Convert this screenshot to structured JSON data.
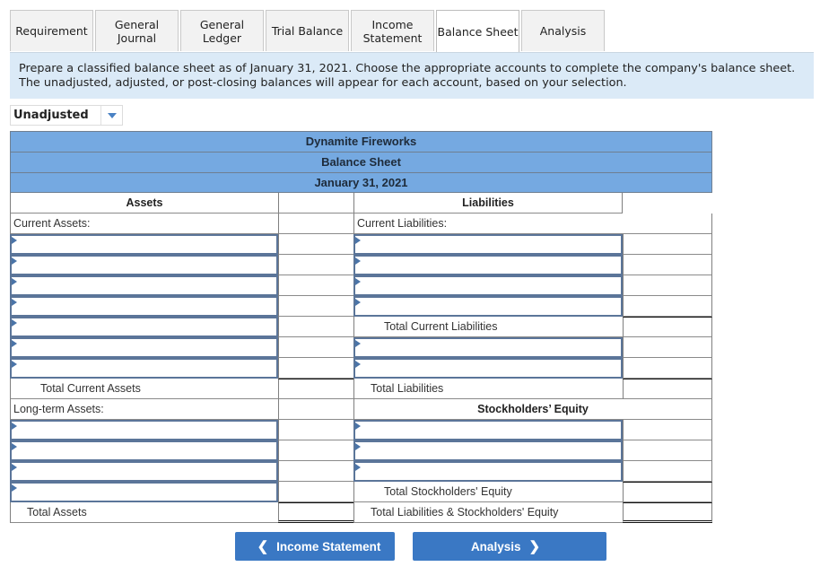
{
  "tabs": [
    {
      "label": "Requirement",
      "active": false
    },
    {
      "label": "General Journal",
      "active": false
    },
    {
      "label": "General Ledger",
      "active": false
    },
    {
      "label": "Trial Balance",
      "active": false
    },
    {
      "label": "Income Statement",
      "active": false
    },
    {
      "label": "Balance Sheet",
      "active": true
    },
    {
      "label": "Analysis",
      "active": false
    }
  ],
  "instructions": "Prepare a classified balance sheet as of January 31, 2021. Choose the appropriate accounts to complete the company's balance sheet. The unadjusted, adjusted, or post-closing balances will appear for each account, based on your selection.",
  "balance_selector": {
    "selected": "Unadjusted"
  },
  "sheet": {
    "company": "Dynamite Fireworks",
    "title": "Balance Sheet",
    "date": "January 31, 2021",
    "assets_header": "Assets",
    "liabilities_header": "Liabilities",
    "current_assets_label": "Current Assets:",
    "current_liabilities_label": "Current Liabilities:",
    "total_current_assets": "Total Current Assets",
    "total_current_liabilities": "Total Current Liabilities",
    "total_liabilities": "Total Liabilities",
    "long_term_assets_label": "Long-term Assets:",
    "equity_header": "Stockholders’ Equity",
    "total_equity": "Total Stockholders' Equity",
    "total_assets": "Total Assets",
    "total_liabilities_equity": "Total Liabilities & Stockholders' Equity"
  },
  "nav": {
    "prev_label": "Income Statement",
    "next_label": "Analysis",
    "prev_icon": "chevron-left-icon",
    "next_icon": "chevron-right-icon"
  },
  "colors": {
    "header_blue": "#75a9e1",
    "button_blue": "#3a78c4",
    "band_blue": "#dbeaf7"
  }
}
